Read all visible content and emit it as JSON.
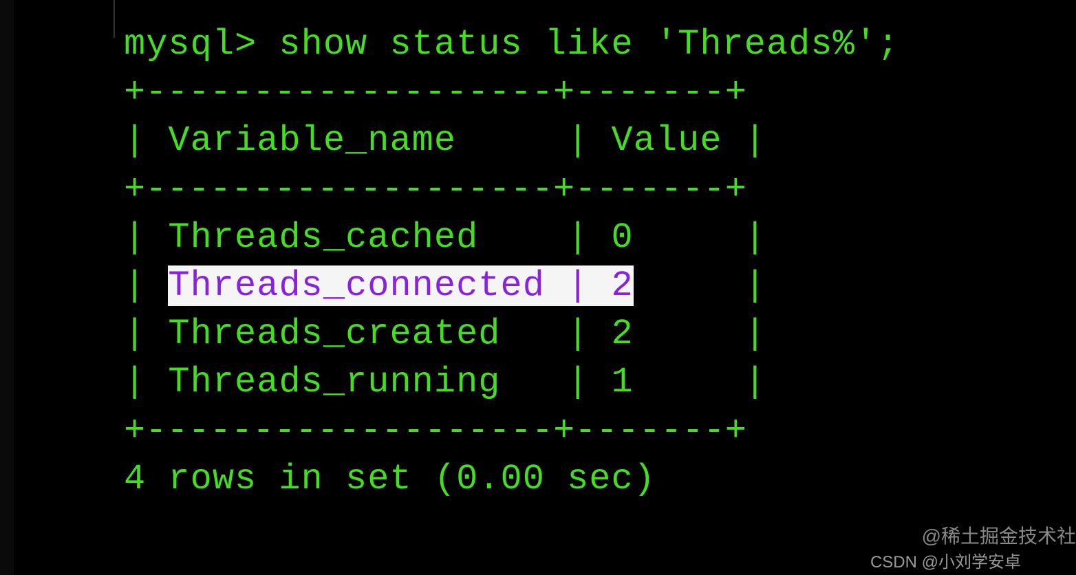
{
  "prompt": "mysql> show status like 'Threads%';",
  "border_line": "+-------------------+-------+",
  "header": {
    "col1": "Variable_name",
    "col2": "Value"
  },
  "rows": [
    {
      "name": "Threads_cached",
      "value": "0",
      "highlighted": false
    },
    {
      "name": "Threads_connected",
      "value": "2",
      "highlighted": true
    },
    {
      "name": "Threads_created",
      "value": "2",
      "highlighted": false
    },
    {
      "name": "Threads_running",
      "value": "1",
      "highlighted": false
    }
  ],
  "footer": "4 rows in set (0.00 sec)",
  "watermark1": "@稀土掘金技术社",
  "watermark2": "CSDN @小刘学安卓",
  "chart_data": {
    "type": "table",
    "title": "show status like 'Threads%'",
    "columns": [
      "Variable_name",
      "Value"
    ],
    "rows": [
      [
        "Threads_cached",
        0
      ],
      [
        "Threads_connected",
        2
      ],
      [
        "Threads_created",
        2
      ],
      [
        "Threads_running",
        1
      ]
    ]
  }
}
